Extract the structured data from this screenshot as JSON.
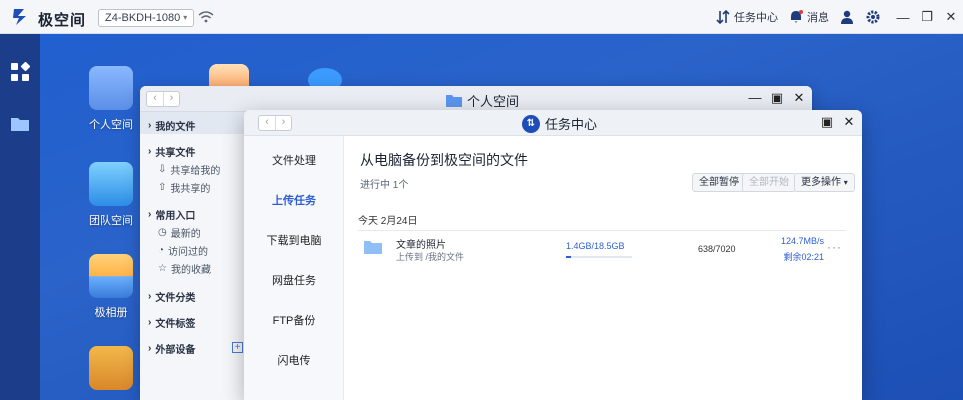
{
  "topbar": {
    "brand": "极空间",
    "device": "Z4-BKDH-1080",
    "task_center": "任务中心",
    "messages": "消息"
  },
  "desktop": {
    "icons": [
      {
        "label": "个人空间"
      },
      {
        "label": "团队空间"
      },
      {
        "label": "极相册"
      },
      {
        "label": ""
      }
    ]
  },
  "back_window": {
    "title": "个人空间",
    "sidebar": {
      "my_files": "我的文件",
      "shared": "共享文件",
      "shared_to_me": "共享给我的",
      "my_shared": "我共享的",
      "common_entry": "常用入口",
      "recent": "最新的",
      "visited": "访问过的",
      "favorites": "我的收藏",
      "file_types": "文件分类",
      "file_tags": "文件标签",
      "external": "外部设备"
    }
  },
  "task_center": {
    "title": "任务中心",
    "tabs": [
      "文件处理",
      "上传任务",
      "下载到电脑",
      "网盘任务",
      "FTP备份",
      "闪电传"
    ],
    "active_tab": "上传任务",
    "heading": "从电脑备份到极空间的文件",
    "in_progress": "进行中 1个",
    "buttons": {
      "pause_all": "全部暂停",
      "start_all": "全部开始",
      "more": "更多操作"
    },
    "date": "今天 2月24日",
    "task": {
      "name": "文章的照片",
      "path": "上传到 /我的文件",
      "size": "1.4GB/18.5GB",
      "progress": 0.08,
      "count": "638/7020",
      "speed": "124.7MB/s",
      "remaining": "剩余02:21"
    }
  }
}
